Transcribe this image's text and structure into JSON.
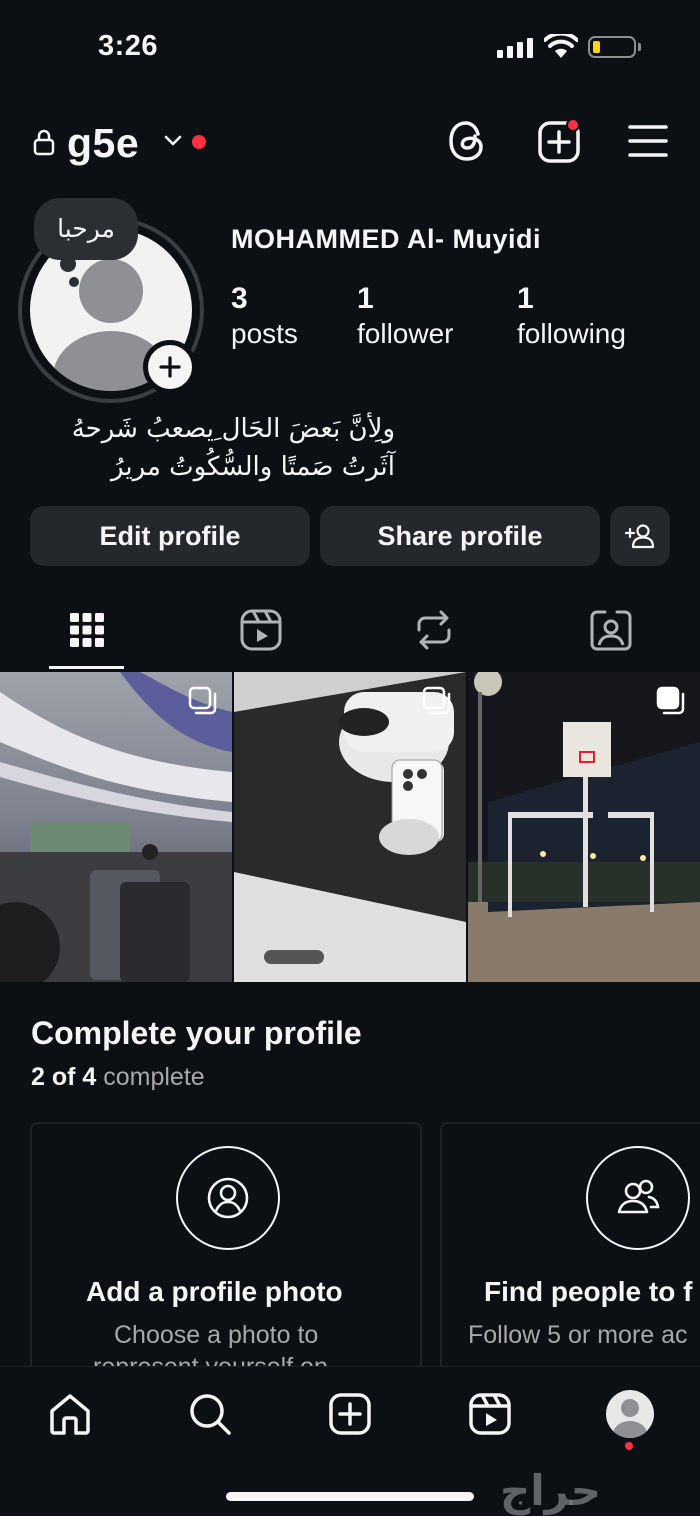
{
  "status_bar": {
    "time": "3:26",
    "battery_color": "#ffd60a"
  },
  "header": {
    "username": "g5e",
    "icons": [
      "lock-icon",
      "chevron-down-icon",
      "threads-icon",
      "create-icon",
      "menu-icon"
    ],
    "notification_color": "#ff3040"
  },
  "profile": {
    "note": "مرحبا",
    "full_name": "MOHAMMED Al- Muyidi",
    "stats": [
      {
        "value": "3",
        "label": "posts"
      },
      {
        "value": "1",
        "label": "follower"
      },
      {
        "value": "1",
        "label": "following"
      }
    ],
    "bio_line1": "ولِأنَّ بَعضَ الحَال ِيصعبُ شَرحهُ",
    "bio_line2": "آثَرتُ صَمتًا والسُّكُوتُ مريرُ"
  },
  "actions": {
    "edit_profile": "Edit profile",
    "share_profile": "Share profile",
    "discover_people_icon": "add-person-icon"
  },
  "tabs": [
    {
      "icon": "grid-icon",
      "active": true
    },
    {
      "icon": "reels-icon",
      "active": false
    },
    {
      "icon": "reposts-icon",
      "active": false
    },
    {
      "icon": "tagged-icon",
      "active": false
    }
  ],
  "posts": [
    {
      "description": "airport terminal",
      "multi": true
    },
    {
      "description": "mirror selfie",
      "multi": true
    },
    {
      "description": "basketball court at night",
      "multi": true
    }
  ],
  "complete_profile": {
    "title": "Complete your profile",
    "progress_done": "2 of 4",
    "progress_rest": "complete",
    "cards": [
      {
        "icon": "profile-photo-icon",
        "title": "Add a profile photo",
        "subtitle_1": "Choose a photo to",
        "subtitle_2": "represent yourself on"
      },
      {
        "icon": "people-icon",
        "title": "Find people to f",
        "subtitle_1": "Follow 5 or more ac",
        "subtitle_2": ""
      }
    ]
  },
  "bottom_nav": {
    "items": [
      "home-icon",
      "search-icon",
      "create-icon",
      "reels-icon",
      "profile-avatar"
    ]
  },
  "watermark": "حراج"
}
